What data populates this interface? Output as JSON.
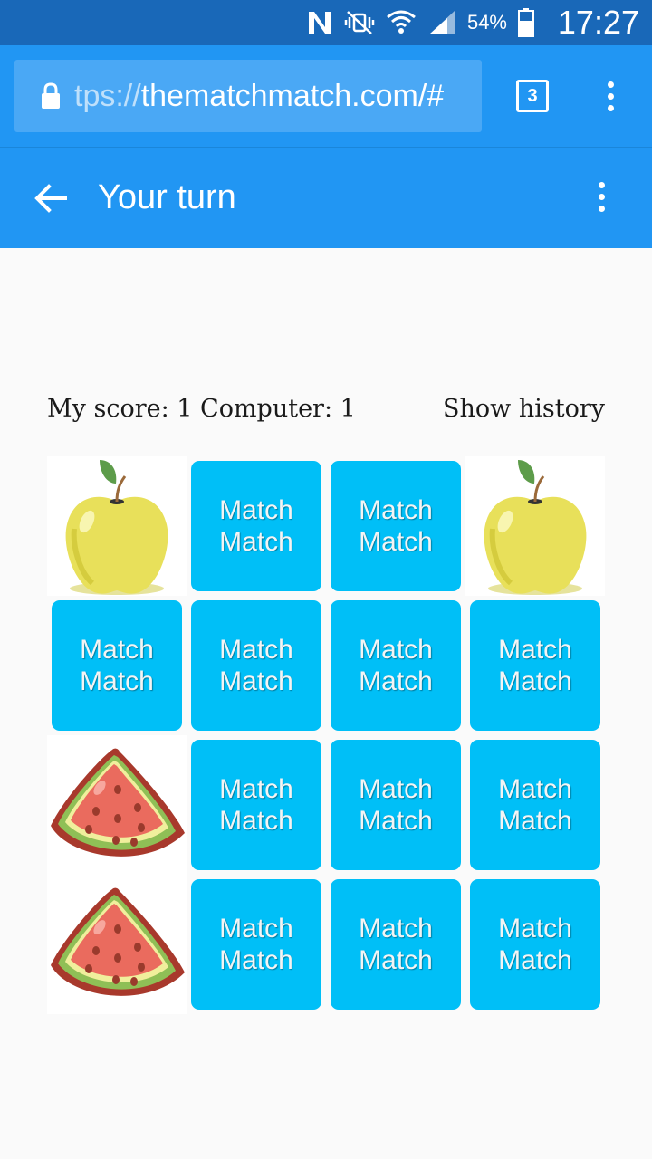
{
  "status_bar": {
    "battery_percent": "54%",
    "time": "17:27",
    "icons": [
      "nfc-icon",
      "mute-vibrate-icon",
      "wifi-icon",
      "signal-icon",
      "battery-icon"
    ]
  },
  "browser": {
    "url_scheme": "tps://",
    "url_host": "thematchmatch.com/#",
    "tab_count": "3",
    "colors": {
      "toolbar": "#2196f3",
      "status": "#1968b8"
    }
  },
  "app_bar": {
    "title": "Your turn"
  },
  "game": {
    "score_text": "My score: 1 Computer: 1",
    "history_label": "Show history",
    "card_back_line1": "Match",
    "card_back_line2": "Match",
    "card_color": "#00bff7",
    "board": [
      [
        "apple",
        "back",
        "back",
        "apple"
      ],
      [
        "back",
        "back",
        "back",
        "back"
      ],
      [
        "watermelon",
        "back",
        "back",
        "back"
      ],
      [
        "watermelon",
        "back",
        "back",
        "back"
      ]
    ]
  }
}
